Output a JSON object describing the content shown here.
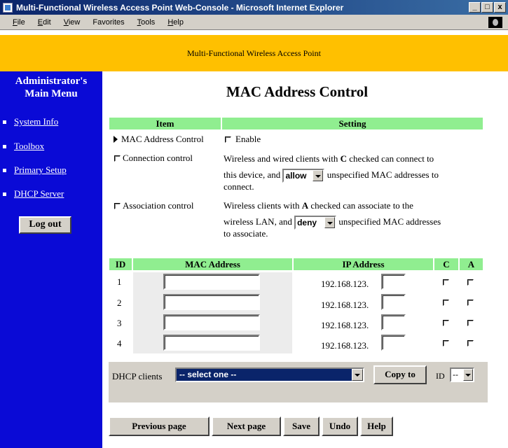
{
  "window": {
    "title": "Multi-Functional Wireless Access Point Web-Console - Microsoft Internet Explorer",
    "min_label": "_",
    "max_label": "□",
    "close_label": "x"
  },
  "menubar": {
    "items": [
      {
        "first": "F",
        "rest": "ile"
      },
      {
        "first": "E",
        "rest": "dit"
      },
      {
        "first": "V",
        "rest": "iew"
      },
      {
        "first": "Fa",
        "rest": "vorites"
      },
      {
        "first": "T",
        "rest": "ools"
      },
      {
        "first": "H",
        "rest": "elp"
      }
    ]
  },
  "banner": {
    "text": "Multi-Functional Wireless Access Point"
  },
  "sidebar": {
    "heading_line1": "Administrator's",
    "heading_line2": "Main Menu",
    "items": [
      {
        "label": "System Info"
      },
      {
        "label": "Toolbox"
      },
      {
        "label": "Primary Setup"
      },
      {
        "label": "DHCP Server"
      }
    ],
    "logout_label": "Log out"
  },
  "page": {
    "title": "MAC Address Control"
  },
  "settings": {
    "col_item": "Item",
    "col_setting": "Setting",
    "mac_control": {
      "label": "MAC Address Control",
      "enable_label": "Enable"
    },
    "connection": {
      "label": "Connection control",
      "text1": "Wireless and wired clients with ",
      "bold": "C",
      "text2": " checked can connect to",
      "text3": "this device, and ",
      "select_value": "allow",
      "text4": " unspecified MAC addresses to",
      "text5": "connect."
    },
    "association": {
      "label": "Association control",
      "text1": "Wireless clients with ",
      "bold": "A",
      "text2": " checked can associate to the",
      "text3": "wireless LAN, and ",
      "select_value": "deny",
      "text4": " unspecified MAC addresses",
      "text5": "to associate."
    }
  },
  "mac_table": {
    "col_id": "ID",
    "col_mac": "MAC Address",
    "col_ip": "IP Address",
    "col_c": "C",
    "col_a": "A",
    "rows": [
      {
        "id": "1",
        "ip_prefix": "192.168.123."
      },
      {
        "id": "2",
        "ip_prefix": "192.168.123."
      },
      {
        "id": "3",
        "ip_prefix": "192.168.123."
      },
      {
        "id": "4",
        "ip_prefix": "192.168.123."
      }
    ]
  },
  "dhcp": {
    "label": "DHCP clients",
    "select_value": "-- select one --",
    "copy_label": "Copy to",
    "id_label": "ID",
    "id_value": "--"
  },
  "buttons": {
    "previous": "Previous page",
    "next": "Next page",
    "save": "Save",
    "undo": "Undo",
    "help": "Help"
  },
  "colors": {
    "banner": "#ffc000",
    "sidebar": "#0a0ad6",
    "header_green": "#90ee90",
    "titlebar": "#0a246a"
  }
}
